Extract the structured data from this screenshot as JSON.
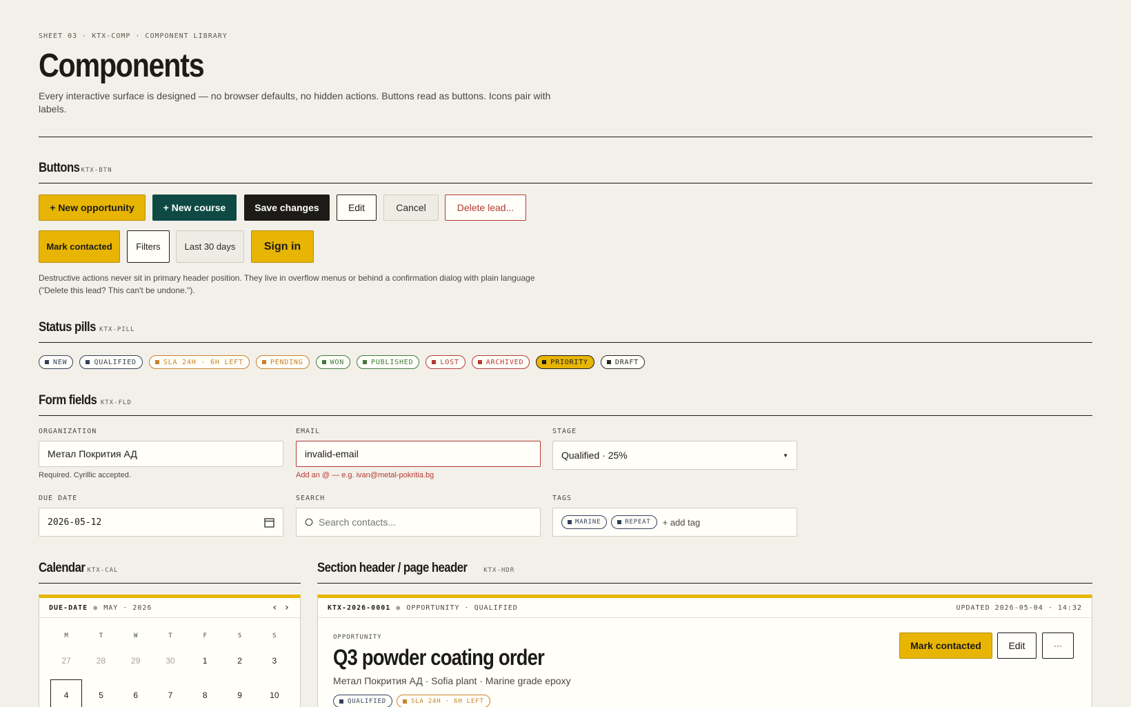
{
  "page": {
    "eyebrow": "SHEET 03 · KTX-COMP · COMPONENT LIBRARY",
    "title": "Components",
    "lede": "Every interactive surface is designed — no browser defaults, no hidden actions. Buttons read as buttons. Icons pair with labels."
  },
  "buttons_section": {
    "title": "Buttons",
    "code": "KTX-BTN",
    "row1": {
      "new_opportunity": "+ New opportunity",
      "new_course": "+ New course",
      "save_changes": "Save changes",
      "edit": "Edit",
      "cancel": "Cancel",
      "delete_lead": "Delete lead..."
    },
    "row2": {
      "mark_contacted": "Mark contacted",
      "filters": "Filters",
      "last_30_days": "Last 30 days",
      "sign_in": "Sign in"
    },
    "note": "Destructive actions never sit in primary header position. They live in overflow menus or behind a confirmation dialog with plain language (\"Delete this lead? This can't be undone.\")."
  },
  "pills_section": {
    "title": "Status pills",
    "code": "KTX-PILL",
    "pills": [
      {
        "label": "NEW",
        "color": "#34405a"
      },
      {
        "label": "QUALIFIED",
        "color": "#34405a"
      },
      {
        "label": "SLA 24H · 6H LEFT",
        "color": "#c9822a"
      },
      {
        "label": "PENDING",
        "color": "#c9822a"
      },
      {
        "label": "WON",
        "color": "#3f7a3a"
      },
      {
        "label": "PUBLISHED",
        "color": "#3f7a3a"
      },
      {
        "label": "LOST",
        "color": "#b43a32"
      },
      {
        "label": "ARCHIVED",
        "color": "#b43a32"
      },
      {
        "label": "PRIORITY",
        "color": "#1c1b18"
      },
      {
        "label": "DRAFT",
        "color": "#2b2924"
      }
    ]
  },
  "form_section": {
    "title": "Form fields",
    "code": "KTX-FLD",
    "organization": {
      "label": "ORGANIZATION",
      "value": "Метал Покрития АД",
      "hint": "Required. Cyrillic accepted."
    },
    "email": {
      "label": "EMAIL",
      "value": "invalid-email",
      "error": "Add an @ — e.g. ivan@metal-pokritia.bg"
    },
    "stage": {
      "label": "STAGE",
      "value": "Qualified · 25%"
    },
    "due_date": {
      "label": "DUE DATE",
      "value": "2026-05-12"
    },
    "search": {
      "label": "SEARCH",
      "placeholder": "Search contacts..."
    },
    "tags": {
      "label": "TAGS",
      "items": [
        "MARINE",
        "REPEAT"
      ],
      "add_label": "+ add tag"
    }
  },
  "calendar_section": {
    "title": "Calendar",
    "code": "KTX-CAL",
    "bar_label": "DUE-DATE",
    "month": "MAY · 2026",
    "prev": "‹",
    "next": "›",
    "dow": [
      "M",
      "T",
      "W",
      "T",
      "F",
      "S",
      "S"
    ],
    "week1": [
      "27",
      "28",
      "29",
      "30",
      "1",
      "2",
      "3"
    ],
    "week2": [
      "4",
      "5",
      "6",
      "7",
      "8",
      "9",
      "10"
    ]
  },
  "header_section": {
    "title": "Section header / page header",
    "code": "KTX-HDR",
    "record_id": "KTX-2026-0001",
    "record_meta": "OPPORTUNITY · QUALIFIED",
    "updated": "UPDATED 2026-05-04 · 14:32",
    "eyebrow": "OPPORTUNITY",
    "heading": "Q3 powder coating order",
    "subtitle": "Метал Покрития АД · Sofia plant · Marine grade epoxy",
    "mark_contacted": "Mark contacted",
    "edit": "Edit",
    "more": "···",
    "pills": [
      {
        "label": "QUALIFIED",
        "color": "#34405a"
      },
      {
        "label": "SLA 24H · 6H LEFT",
        "color": "#c9822a"
      }
    ]
  }
}
